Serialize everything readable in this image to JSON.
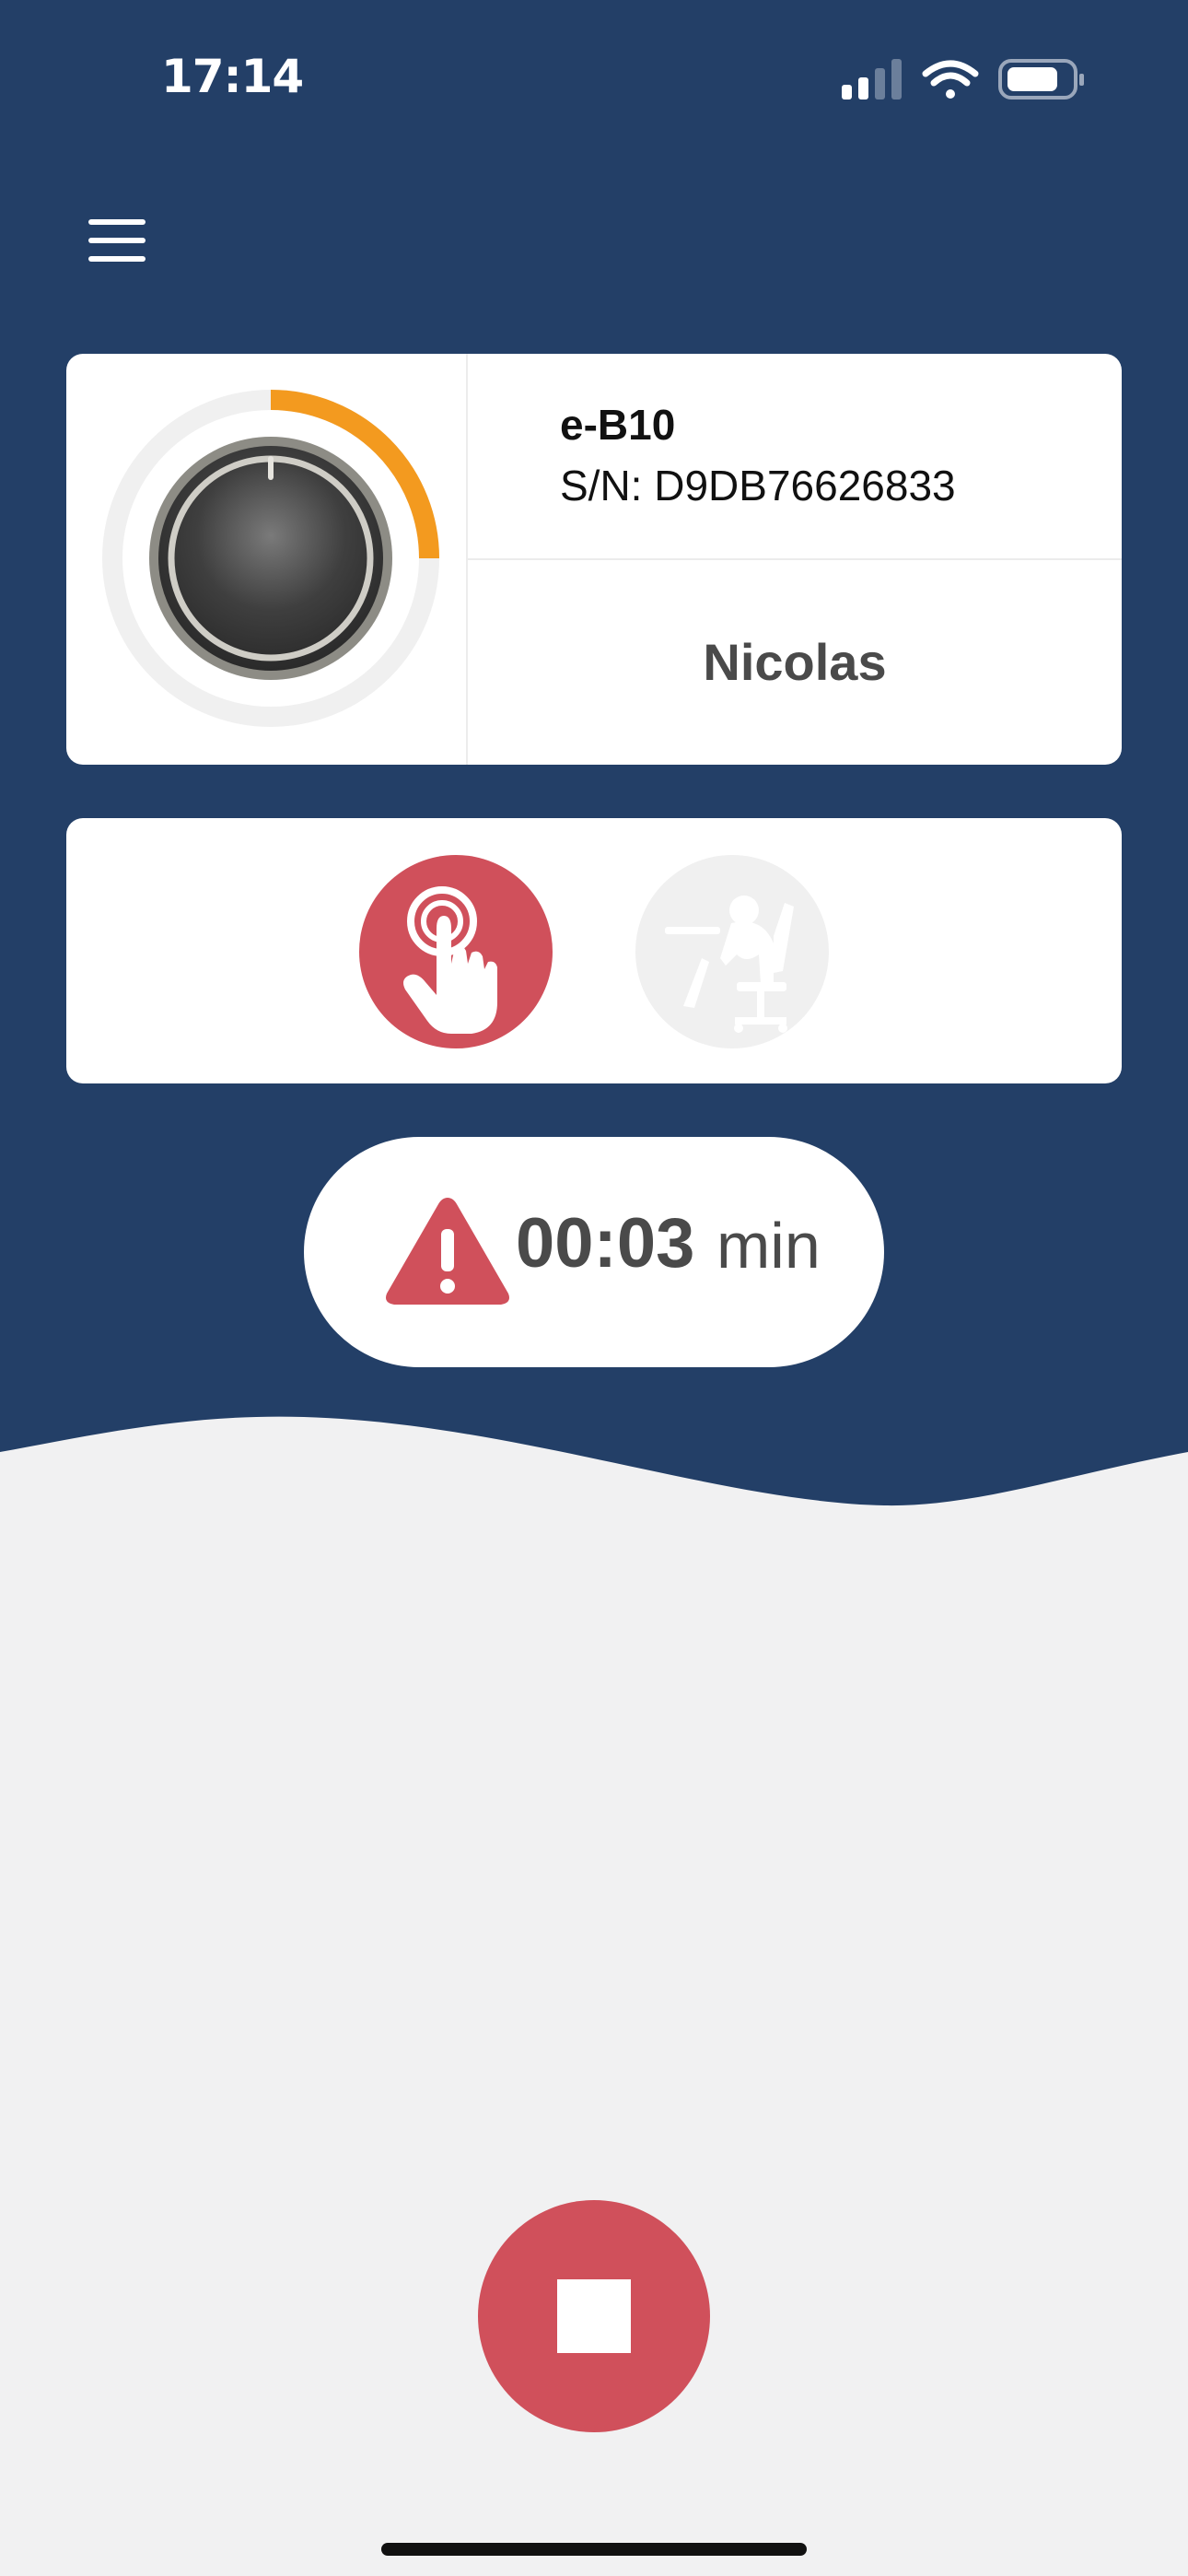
{
  "status_bar": {
    "time": "17:14",
    "signal_icon": "cellular-signal-icon",
    "wifi_icon": "wifi-icon",
    "battery_icon": "battery-icon"
  },
  "header": {
    "menu_icon": "hamburger-menu-icon"
  },
  "device": {
    "model": "e-B10",
    "serial": "S/N: D9DB76626833",
    "user": "Nicolas",
    "level_fraction": 0.25,
    "knob_icon": "control-knob-icon"
  },
  "modes": [
    {
      "icon": "touch-hand-icon",
      "active": true
    },
    {
      "icon": "person-slumped-chair-icon",
      "active": false
    }
  ],
  "timer": {
    "value": "00:03",
    "unit": "min",
    "icon": "warning-triangle-icon"
  },
  "stop": {
    "icon": "stop-square-icon"
  },
  "colors": {
    "header_bg": "#233f67",
    "accent_red": "#d0505b",
    "accent_orange": "#f39a1f",
    "page_bg": "#f1f1f2"
  }
}
